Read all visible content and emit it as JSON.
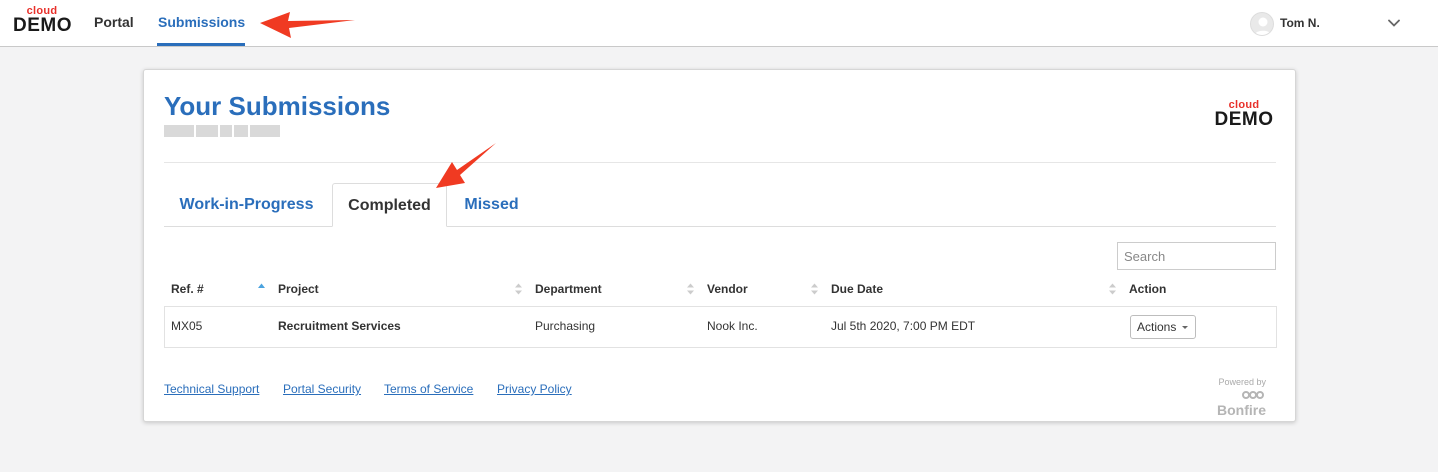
{
  "brand": {
    "cloud": "cloud",
    "demo": "DEMO"
  },
  "nav": {
    "items": [
      {
        "label": "Portal"
      },
      {
        "label": "Submissions",
        "active": true
      }
    ]
  },
  "user": {
    "name": "Tom N.",
    "icon": "chevron-down-icon"
  },
  "page": {
    "title": "Your Submissions"
  },
  "tabs": [
    {
      "label": "Work-in-Progress"
    },
    {
      "label": "Completed",
      "active": true
    },
    {
      "label": "Missed"
    }
  ],
  "search": {
    "placeholder": "Search",
    "value": ""
  },
  "table": {
    "columns": [
      "Ref. #",
      "Project",
      "Department",
      "Vendor",
      "Due Date",
      "Action"
    ],
    "rows": [
      {
        "ref": "MX05",
        "project": "Recruitment Services",
        "department": "Purchasing",
        "vendor": "Nook Inc.",
        "due_date": "Jul 5th 2020, 7:00 PM EDT",
        "action": "Actions"
      }
    ]
  },
  "footer": {
    "links": [
      "Technical Support",
      "Portal Security",
      "Terms of Service",
      "Privacy Policy"
    ],
    "powered_by": "Powered by",
    "powered_brand": "Bonfire"
  },
  "colors": {
    "accent": "#2a6ebb",
    "brand_red": "#e8302a",
    "annotation_arrow": "#f03a22"
  }
}
